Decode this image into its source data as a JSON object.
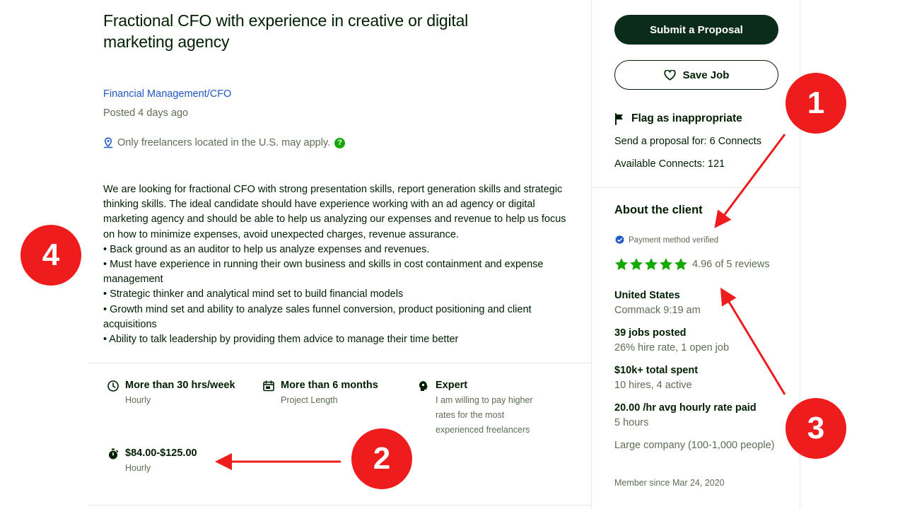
{
  "job": {
    "title": "Fractional CFO with experience in creative or digital marketing agency",
    "category": "Financial Management/CFO",
    "posted": "Posted 4 days ago",
    "location_note": "Only freelancers located in the U.S. may apply.",
    "help_glyph": "?",
    "description": [
      "We are looking for fractional CFO with strong presentation skills, report generation skills and strategic thinking skills. The ideal candidate should have experience working with an ad agency or digital marketing agency and should be able to help us analyzing our expenses and revenue to help us focus on how to minimize expenses, avoid unexpected charges, revenue assurance.",
      "• Back ground as an auditor to help us analyze expenses and revenues.",
      "• Must have experience in running their own business and skills in cost containment and expense management",
      "• Strategic thinker and analytical mind set to build financial models",
      "• Growth mind set and ability to analyze sales funnel conversion, product positioning and client acquisitions",
      "• Ability to talk leadership by providing them advice to manage their time better"
    ],
    "features": {
      "hours": {
        "title": "More than 30 hrs/week",
        "sub": "Hourly",
        "icon": "clock-icon"
      },
      "duration": {
        "title": "More than 6 months",
        "sub": "Project Length",
        "icon": "calendar-icon"
      },
      "level": {
        "title": "Expert",
        "sub": "I am willing to pay higher rates for the most experienced freelancers",
        "icon": "brain-icon"
      },
      "rate": {
        "title": "$84.00-$125.00",
        "sub": "Hourly",
        "icon": "stopwatch-icon"
      }
    }
  },
  "sidebar": {
    "submit_label": "Submit a Proposal",
    "save_label": "Save Job",
    "flag_label": "Flag as inappropriate",
    "connects_required": "Send a proposal for: 6 Connects",
    "connects_available": "Available Connects: 121"
  },
  "client": {
    "heading": "About the client",
    "payment_verified": "Payment method verified",
    "rating": "4.96 of 5 reviews",
    "stars": 5,
    "country": "United States",
    "city_time": "Commack 9:19 am",
    "jobs_posted": "39 jobs posted",
    "hire_rate": "26% hire rate, 1 open job",
    "total_spent": "$10k+ total spent",
    "hires": "10 hires, 4 active",
    "avg_rate_value": "20.00",
    "avg_rate_label": " /hr avg hourly rate paid",
    "hours": "5 hours",
    "company_size": "Large company (100-1,000 people)",
    "member_since": "Member since Mar 24, 2020"
  },
  "annotations": {
    "markers": [
      "1",
      "2",
      "3",
      "4"
    ],
    "color": "#ee1c1c"
  },
  "colors": {
    "brand_dark": "#0b2b1b",
    "link": "#1f57c3",
    "muted": "#5e6d55",
    "star": "#14a800"
  }
}
